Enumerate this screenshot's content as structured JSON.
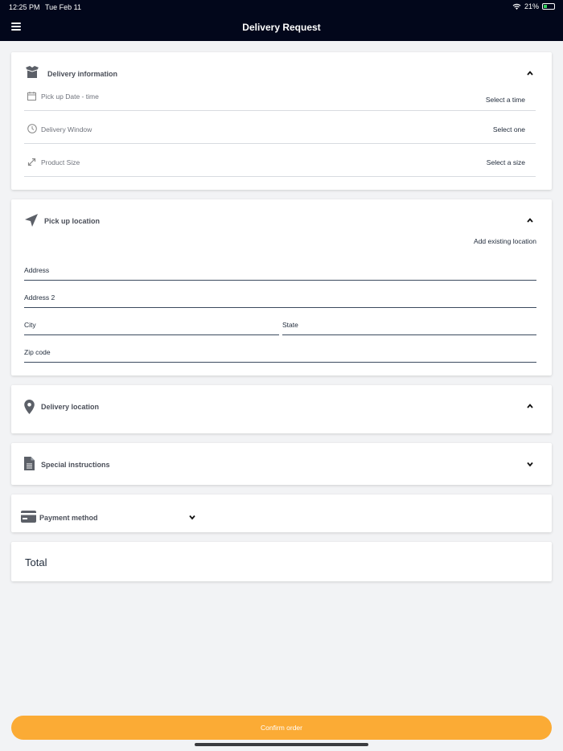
{
  "status": {
    "time": "12:25 PM",
    "date": "Tue Feb 11",
    "battery": "21%"
  },
  "header": {
    "title": "Delivery Request"
  },
  "delivery_info": {
    "title": "Delivery information",
    "rows": [
      {
        "label": "Pick up Date - time",
        "value": "Select a time"
      },
      {
        "label": "Delivery Window",
        "value": "Select one"
      },
      {
        "label": "Product Size",
        "value": "Select a size"
      }
    ]
  },
  "pickup": {
    "title": "Pick up location",
    "add_existing": "Add existing location",
    "fields": {
      "address": "Address",
      "address2": "Address 2",
      "city": "City",
      "state": "State",
      "zip": "Zip code"
    }
  },
  "delivery_location": {
    "title": "Delivery location"
  },
  "special": {
    "title": "Special instructions"
  },
  "payment": {
    "title": "Payment method"
  },
  "total": {
    "label": "Total"
  },
  "confirm": {
    "label": "Confirm order"
  },
  "colors": {
    "header_bg": "#02071b",
    "accent": "#fbab35",
    "page_bg": "#f2f3f5"
  }
}
